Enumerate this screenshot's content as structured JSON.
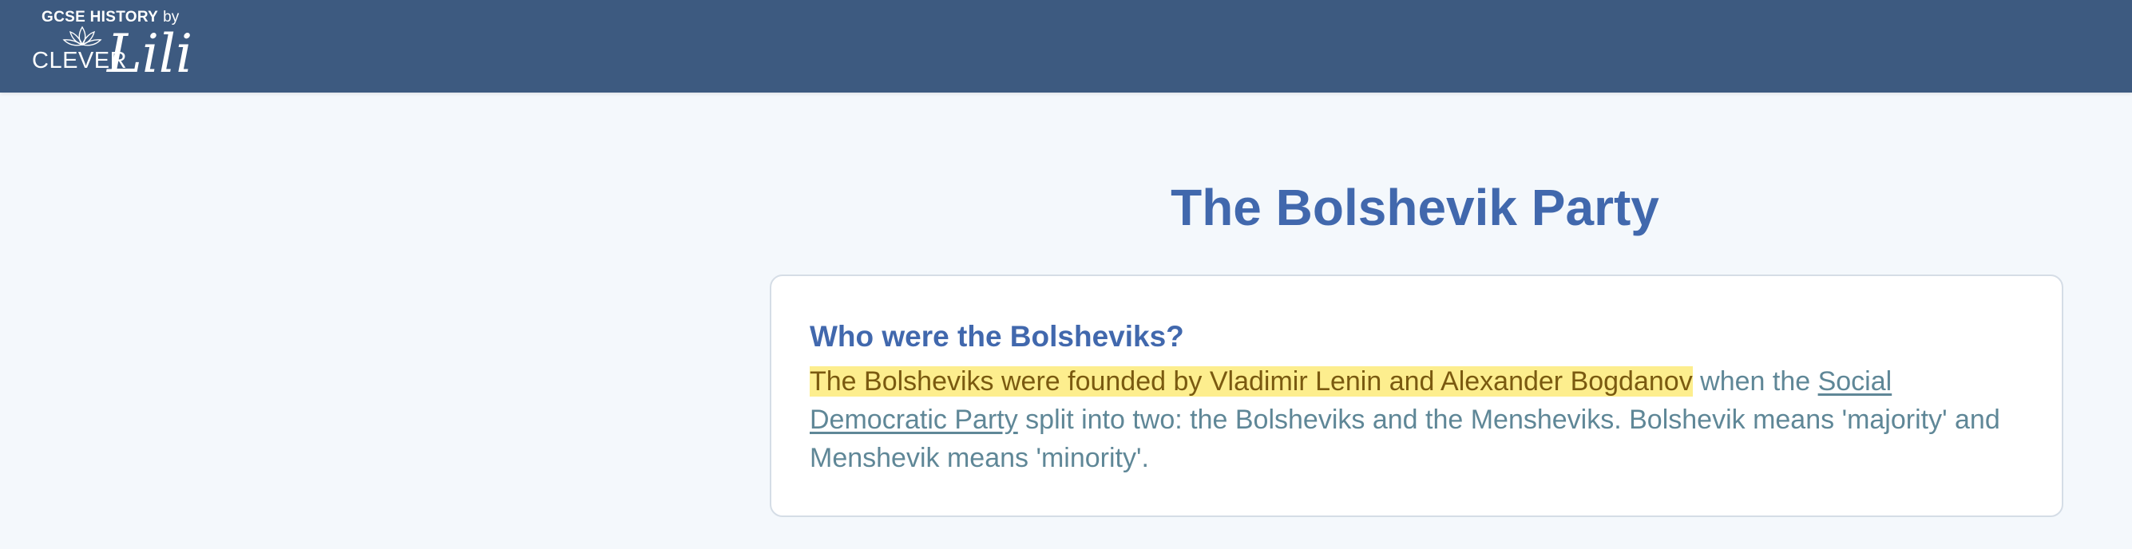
{
  "header": {
    "logo": {
      "top_label": "GCSE HISTORY",
      "by_label": "by",
      "brand_left": "CLEVER",
      "brand_right": "Lili"
    }
  },
  "main": {
    "title": "The Bolshevik Party",
    "card": {
      "heading": "Who were the Bolsheviks?",
      "highlight_text": "The Bolsheviks were founded by Vladimir Lenin and Alexander Bogdanov",
      "text_before_link": " when the ",
      "link_text": "Social Democratic Party",
      "text_after_link": " split into two: the Bolsheviks and the Mensheviks. Bolshevik means 'majority' and Menshevik means 'minority'."
    }
  },
  "colors": {
    "header_bg": "#3d5a80",
    "page_bg": "#f4f8fc",
    "title": "#4168ad",
    "body_text": "#5f8797",
    "highlight_bg": "#fdee8e"
  },
  "icons": {
    "logo_flower": "lotus-flower-icon"
  }
}
